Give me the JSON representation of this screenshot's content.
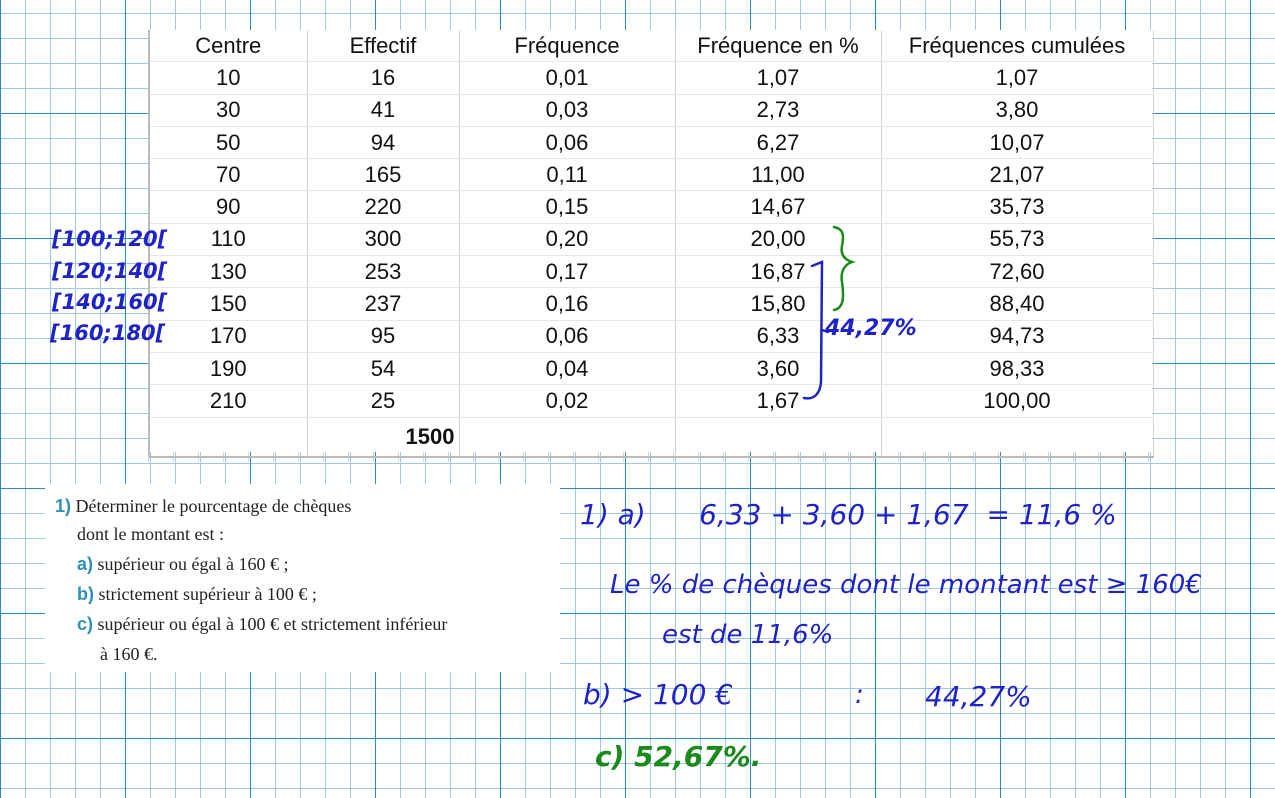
{
  "table": {
    "headers": [
      "Centre",
      "Effectif",
      "Fréquence",
      "Fréquence en %",
      "Fréquences cumulées"
    ],
    "rows": [
      [
        "10",
        "16",
        "0,01",
        "1,07",
        "1,07"
      ],
      [
        "30",
        "41",
        "0,03",
        "2,73",
        "3,80"
      ],
      [
        "50",
        "94",
        "0,06",
        "6,27",
        "10,07"
      ],
      [
        "70",
        "165",
        "0,11",
        "11,00",
        "21,07"
      ],
      [
        "90",
        "220",
        "0,15",
        "14,67",
        "35,73"
      ],
      [
        "110",
        "300",
        "0,20",
        "20,00",
        "55,73"
      ],
      [
        "130",
        "253",
        "0,17",
        "16,87",
        "72,60"
      ],
      [
        "150",
        "237",
        "0,16",
        "15,80",
        "88,40"
      ],
      [
        "170",
        "95",
        "0,06",
        "6,33",
        "94,73"
      ],
      [
        "190",
        "54",
        "0,04",
        "3,60",
        "98,33"
      ],
      [
        "210",
        "25",
        "0,02",
        "1,67",
        "100,00"
      ]
    ],
    "total": "1500"
  },
  "intervals": [
    "[100;120[",
    "[120;140[",
    "[140;160[",
    "[160;180["
  ],
  "exercise": {
    "number": "1)",
    "line1": "Déterminer le pourcentage de chèques",
    "line2": "dont le montant est :",
    "a_label": "a)",
    "a_text": "supérieur ou égal à 160 € ;",
    "b_label": "b)",
    "b_text": "strictement supérieur à 100 € ;",
    "c_label": "c)",
    "c_text": "supérieur ou égal à 100 € et strictement inférieur",
    "c_text2": "à 160 €."
  },
  "handwriting": {
    "brace_sum": "44,27%",
    "line_a": "1) a)      6,33 + 3,60 + 1,67  = 11,6 %",
    "line_a_sentence": "Le % de chèques dont le montant est ≥ 160€",
    "line_a_sentence2": "est de 11,6%",
    "line_b_label": "b) > 100 €",
    "line_b_colon": ":",
    "line_b_value": "44,27%",
    "line_c": "c) 52,67%."
  },
  "colors": {
    "grid_major": "#2f86d8",
    "grid_minor": "#9ec9ee",
    "ink_blue": "#1f22c6",
    "ink_green": "#1a8a1a",
    "exercise_accent": "#2e8fb8"
  }
}
